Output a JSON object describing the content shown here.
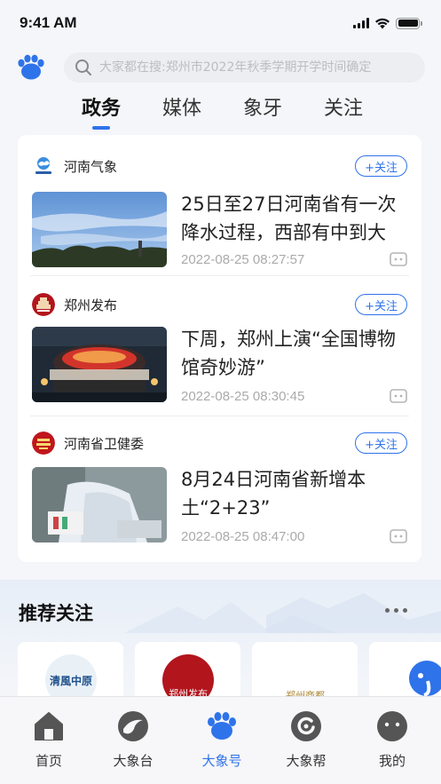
{
  "status_bar": {
    "time": "9:41 AM"
  },
  "search": {
    "placeholder": "大家都在搜:郑州市2022年秋季学期开学时间确定"
  },
  "tabs": [
    {
      "label": "政务",
      "active": true
    },
    {
      "label": "媒体"
    },
    {
      "label": "象牙"
    },
    {
      "label": "关注"
    }
  ],
  "feed": [
    {
      "source": "河南气象",
      "follow": "+关注",
      "title": "25日至27日河南省有一次降水过程，西部有中到大",
      "time": "2022-08-25 08:27:57",
      "avatar_label": "河南气象"
    },
    {
      "source": "郑州发布",
      "follow": "+关注",
      "title": "下周，郑州上演“全国博物馆奇妙游”",
      "time": "2022-08-25 08:30:45",
      "avatar_label": "郑州发布"
    },
    {
      "source": "河南省卫健委",
      "follow": "+关注",
      "title": "8月24日河南省新增本土“2+23”",
      "time": "2022-08-25 08:47:00",
      "avatar_label": "河南省卫健委"
    }
  ],
  "recommend": {
    "title": "推荐关注",
    "cards": [
      {
        "avatar_text": "清風中原"
      },
      {
        "avatar_text": "郑州发布"
      },
      {
        "avatar_text": "郑州商都"
      },
      {
        "avatar_text": ""
      }
    ]
  },
  "bottom_nav": [
    {
      "label": "首页",
      "icon": "home-icon"
    },
    {
      "label": "大象台",
      "icon": "tv-icon"
    },
    {
      "label": "大象号",
      "icon": "paw-icon",
      "active": true
    },
    {
      "label": "大象帮",
      "icon": "help-icon"
    },
    {
      "label": "我的",
      "icon": "profile-icon"
    }
  ],
  "colors": {
    "accent": "#2f73ea",
    "text": "#222222",
    "muted": "#aaaaaa"
  }
}
